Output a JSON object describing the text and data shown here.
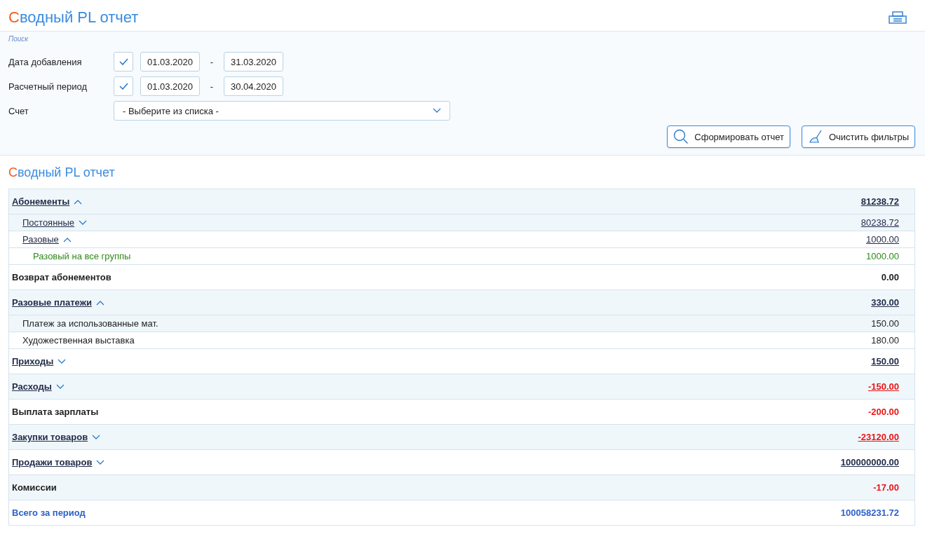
{
  "header": {
    "title_initial": "С",
    "title_rest": "водный PL отчет"
  },
  "filters": {
    "legend": "Поиск",
    "date_rows": [
      {
        "label": "Дата добавления",
        "checked": true,
        "from": "01.03.2020",
        "separator": "-",
        "to": "31.03.2020"
      },
      {
        "label": "Расчетный период",
        "checked": true,
        "from": "01.03.2020",
        "separator": "-",
        "to": "30.04.2020"
      }
    ],
    "account": {
      "label": "Счет",
      "value": "- Выберите из списка -"
    },
    "buttons": [
      {
        "kind": "search",
        "label": "Сформировать отчет"
      },
      {
        "kind": "clear",
        "label": "Очистить фильтры"
      }
    ]
  },
  "report": {
    "title_initial": "С",
    "title_rest": "водный PL отчет",
    "rows": [
      {
        "kind": "group",
        "label": "Абонементы",
        "amount": "81238.72",
        "negative": false,
        "expanded": true,
        "children": [
          {
            "kind": "subgroup",
            "label": "Постоянные",
            "amount": "80238.72",
            "negative": false,
            "expanded": false
          },
          {
            "kind": "subgroup",
            "label": "Разовые",
            "amount": "1000.00",
            "negative": false,
            "expanded": true,
            "children": [
              {
                "kind": "entry",
                "label": "Разовый на все группы",
                "amount": "1000.00",
                "negative": false
              }
            ]
          }
        ]
      },
      {
        "kind": "summary",
        "label": "Возврат абонементов",
        "amount": "0.00",
        "negative": false
      },
      {
        "kind": "group",
        "label": "Разовые платежи",
        "amount": "330.00",
        "negative": false,
        "expanded": true,
        "children": [
          {
            "kind": "item",
            "label": "Платеж за использованные мат.",
            "amount": "150.00",
            "negative": false
          },
          {
            "kind": "item",
            "label": "Художественная выставка",
            "amount": "180.00",
            "negative": false
          }
        ]
      },
      {
        "kind": "group",
        "label": "Приходы",
        "amount": "150.00",
        "negative": false,
        "expanded": false
      },
      {
        "kind": "group",
        "label": "Расходы",
        "amount": "-150.00",
        "negative": true,
        "expanded": false
      },
      {
        "kind": "summary",
        "label": "Выплата зарплаты",
        "amount": "-200.00",
        "negative": true
      },
      {
        "kind": "group",
        "label": "Закупки товаров",
        "amount": "-23120.00",
        "negative": true,
        "expanded": false
      },
      {
        "kind": "group",
        "label": "Продажи товаров",
        "amount": "100000000.00",
        "negative": false,
        "expanded": false
      },
      {
        "kind": "summary",
        "label": "Комиссии",
        "amount": "-17.00",
        "negative": true
      },
      {
        "kind": "total",
        "label": "Всего за период",
        "amount": "100058231.72",
        "negative": false
      }
    ]
  }
}
